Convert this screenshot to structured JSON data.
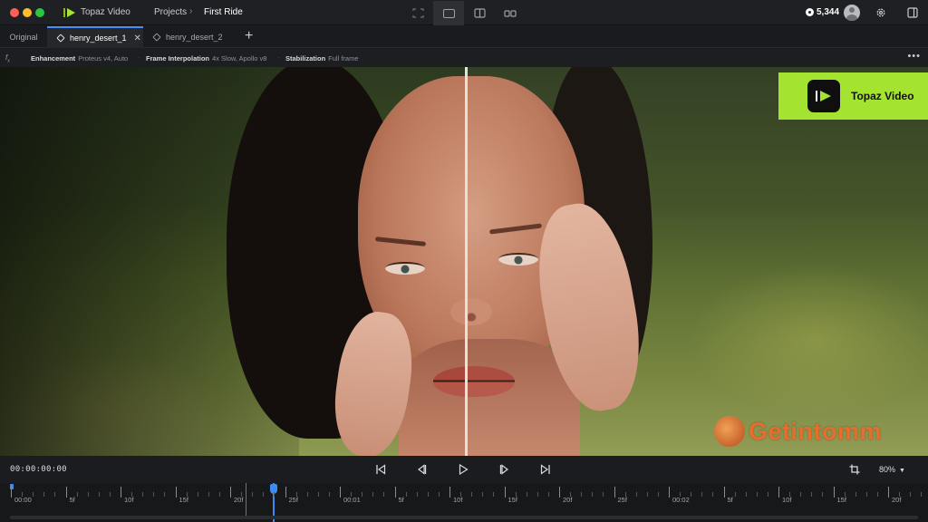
{
  "app": {
    "name": "Topaz Video",
    "breadcrumb": [
      "Projects",
      "First Ride"
    ],
    "credits": "5,344"
  },
  "tabs": [
    {
      "label": "Original"
    },
    {
      "label": "henry_desert_1"
    },
    {
      "label": "henry_desert_2"
    }
  ],
  "settings": [
    {
      "key": "Enhancement",
      "value": "Proteus v4, Auto"
    },
    {
      "key": "Frame Interpolation",
      "value": "4x Slow, Apollo v8"
    },
    {
      "key": "Stabilization",
      "value": "Full frame"
    }
  ],
  "preview": {
    "promo_label": "Topaz Video",
    "watermark": "Getintomm"
  },
  "transport": {
    "timecode": "00:00:00:00",
    "zoom": "80%"
  },
  "timeline": {
    "labels": [
      "00:00",
      "5f",
      "10f",
      "15f",
      "20f",
      "25f",
      "00:01",
      "5f",
      "10f",
      "15f",
      "20f",
      "25f",
      "00:02",
      "5f",
      "10f",
      "15f",
      "20f"
    ]
  },
  "colors": {
    "accent": "#3d8bf0",
    "brand": "#a4e32f",
    "in_point": "#d64a4a"
  },
  "icons": [
    "topaz-logo-icon",
    "crop-icon",
    "settings-icon",
    "sidebar-toggle-icon",
    "skip-start-icon",
    "step-back-icon",
    "play-icon",
    "step-forward-icon",
    "skip-end-icon"
  ]
}
